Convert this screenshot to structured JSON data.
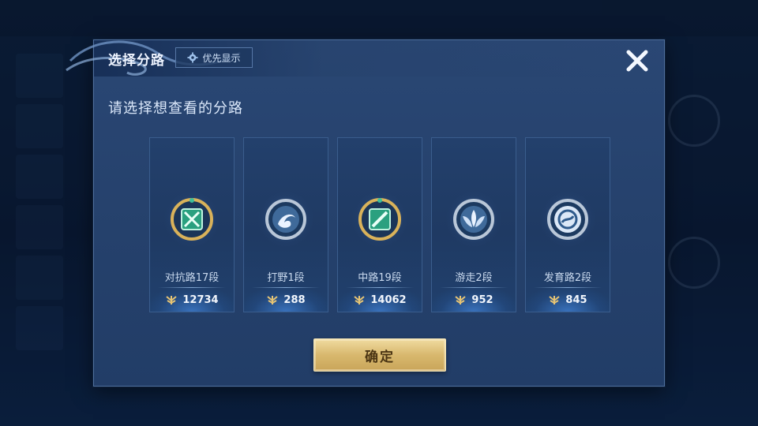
{
  "dialog": {
    "title": "选择分路",
    "priority_label": "优先显示",
    "subtitle": "请选择想查看的分路",
    "confirm_label": "确定"
  },
  "lanes": [
    {
      "label": "对抗路17段",
      "points": "12734",
      "icon": "clash-lane-icon",
      "frame": "gold"
    },
    {
      "label": "打野1段",
      "points": "288",
      "icon": "jungle-icon",
      "frame": "silver"
    },
    {
      "label": "中路19段",
      "points": "14062",
      "icon": "mid-lane-icon",
      "frame": "gold"
    },
    {
      "label": "游走2段",
      "points": "952",
      "icon": "roam-icon",
      "frame": "silver"
    },
    {
      "label": "发育路2段",
      "points": "845",
      "icon": "farm-lane-icon",
      "frame": "silver"
    }
  ],
  "colors": {
    "gold_frame": "#d9b25a",
    "silver_frame": "#b9c7d8",
    "emerald": "#3fbf9a",
    "confirm": "#d8b86e"
  }
}
